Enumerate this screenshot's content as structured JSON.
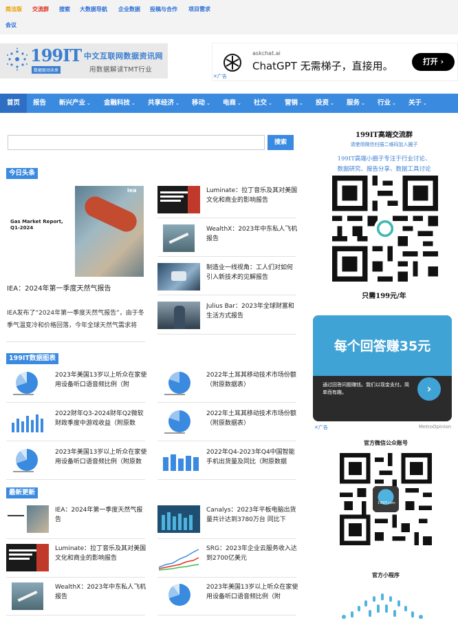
{
  "toplinks": [
    {
      "label": "简洁版",
      "color": "#e8a000"
    },
    {
      "label": "交流群",
      "color": "#e0301e"
    },
    {
      "label": "搜索",
      "color": "#2e6fd6"
    },
    {
      "label": "大数据导航",
      "color": "#2e6fd6"
    },
    {
      "label": "企业数据",
      "color": "#2e6fd6"
    },
    {
      "label": "投稿与合作",
      "color": "#2e6fd6"
    },
    {
      "label": "项目需求",
      "color": "#2e6fd6"
    },
    {
      "label": "会议",
      "color": "#2e6fd6"
    }
  ],
  "logo": {
    "number": "199IT",
    "slogan": "数据驱动未来",
    "title": "中文互联网数据资讯网",
    "subtitle": "用数据解读TMT行业"
  },
  "ad_banner": {
    "site": "askchat.ai",
    "text": "ChatGPT 无需梯子，直接用。",
    "button": "打开",
    "adchoice": "✕广告"
  },
  "nav": [
    {
      "label": "首页",
      "caret": false
    },
    {
      "label": "报告",
      "caret": false
    },
    {
      "label": "新兴产业",
      "caret": true
    },
    {
      "label": "金融科技",
      "caret": true
    },
    {
      "label": "共享经济",
      "caret": true
    },
    {
      "label": "移动",
      "caret": true
    },
    {
      "label": "电商",
      "caret": true
    },
    {
      "label": "社交",
      "caret": true
    },
    {
      "label": "营销",
      "caret": true
    },
    {
      "label": "投资",
      "caret": true
    },
    {
      "label": "服务",
      "caret": true
    },
    {
      "label": "行业",
      "caret": true
    },
    {
      "label": "关于",
      "caret": true
    }
  ],
  "search": {
    "placeholder": "",
    "button": "搜索"
  },
  "sections": {
    "headlines": "今日头条",
    "datacharts": "199IT数据图表",
    "latest": "最新更新"
  },
  "headline": {
    "title": "IEA：2024年第一季度天然气报告",
    "desc": "IEA发布了“2024年第一季度天然气报告”，由于冬季气温变冷和价格回落，今年全球天然气需求将",
    "image_brand": "iea",
    "image_caption": "Gas Market Report, Q1-2024"
  },
  "headline_side": [
    {
      "text": "Luminate：拉丁音乐及其对美国文化和商业的影响报告",
      "thumb": "luminate"
    },
    {
      "text": "WealthX：2023年中东私人飞机报告",
      "thumb": "jet"
    },
    {
      "text": "制造业一线视角：工人们对如何引入新技术的见解报告",
      "thumb": "vr"
    },
    {
      "text": "Julius Bar：2023年全球财富和生活方式报告",
      "thumb": "people"
    }
  ],
  "datacharts": [
    {
      "text": "2023年美国13岁以上听众在家使用设备听口语音频比例（附",
      "thumb": "pie"
    },
    {
      "text": "2022年土耳其移动技术市场份额（附原数据表）",
      "thumb": "pie"
    },
    {
      "text": "2022财年Q3-2024财年Q2微软财政季度中游戏收益（附原数",
      "thumb": "bars"
    },
    {
      "text": "2022年土耳其移动技术市场份额（附原数据表）",
      "thumb": "pie"
    },
    {
      "text": "2023年美国13岁以上听众在家使用设备听口语音频比例（附原数",
      "thumb": "pie"
    },
    {
      "text": "2022年Q4-2023年Q4中国智能手机出货量及同比（附原数据",
      "thumb": "bars"
    }
  ],
  "latest": [
    {
      "text": "IEA：2024年第一季度天然气报告",
      "thumb": "gas"
    },
    {
      "text": "Canalys：2023年平板电脑出货量共计达到3780万台 同比下",
      "thumb": "tablet"
    },
    {
      "text": "Luminate：拉丁音乐及其对美国文化和商业的影响报告",
      "thumb": "luminate"
    },
    {
      "text": "SRG：2023年企业云服务收入达到2700亿美元",
      "thumb": "line"
    },
    {
      "text": "WealthX：2023年中东私人飞机报告",
      "thumb": "jet"
    },
    {
      "text": "2023年美国13岁以上听众在家使用设备听口语音频比例（附",
      "thumb": "pie"
    }
  ],
  "qr_panel": {
    "title": "199IT高端交流群",
    "note": "请使用微信扫描二维码加入圈子",
    "desc1": "199IT高端小圈子专注于行业讨论、",
    "desc2": "数据研究、报告分享、数据工具讨论",
    "price": "只需199元/年"
  },
  "ad2": {
    "headline": "每个回答赚35元",
    "body": "通过回答问题赚钱。我们以现金支付。简单而有趣。",
    "adchoice": "✕广告",
    "brand": "MetroOpinion"
  },
  "wechat": {
    "title": "官方微信公众账号",
    "center": "199IT.com"
  },
  "mini": {
    "title": "官方小程序"
  },
  "colors": {
    "brand_blue": "#3a8ae0",
    "nav_active": "#2e6fc4"
  }
}
